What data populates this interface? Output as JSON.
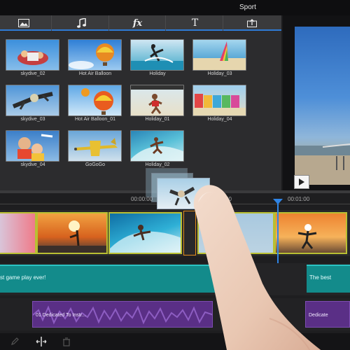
{
  "window": {
    "title": "Sport"
  },
  "tabs": [
    {
      "name": "image-tab",
      "icon": "image-icon"
    },
    {
      "name": "music-tab",
      "icon": "music-note-icon"
    },
    {
      "name": "fx-tab",
      "label": "fx",
      "icon": "fx-icon"
    },
    {
      "name": "title-tab",
      "label": "T",
      "icon": "text-icon"
    },
    {
      "name": "export-tab",
      "icon": "export-icon"
    }
  ],
  "media": [
    {
      "caption": "skydive_02"
    },
    {
      "caption": "Hot Air Balloon"
    },
    {
      "caption": "Holiday"
    },
    {
      "caption": "Holiday_03"
    },
    {
      "caption": "skydive_03"
    },
    {
      "caption": "Hot Air Balloon_01"
    },
    {
      "caption": "Holiday_01"
    },
    {
      "caption": "Holiday_04"
    },
    {
      "caption": "skydive_04"
    },
    {
      "caption": "GoGoGo"
    },
    {
      "caption": "Holiday_02"
    }
  ],
  "timeline": {
    "ticks": [
      "00:00:00",
      "00",
      "30",
      "00:01:00"
    ],
    "title_clip_1": "st game play ever!",
    "title_clip_2": "The best",
    "music_clip_1": "01 Dedicated To Instr...",
    "music_clip_2": "Dedicate"
  },
  "colors": {
    "accent": "#2f7bd6",
    "playhead": "#2f85e6",
    "video_border": "#b9bf33",
    "title_track": "#138b8b",
    "music_track": "#5a2f86"
  }
}
